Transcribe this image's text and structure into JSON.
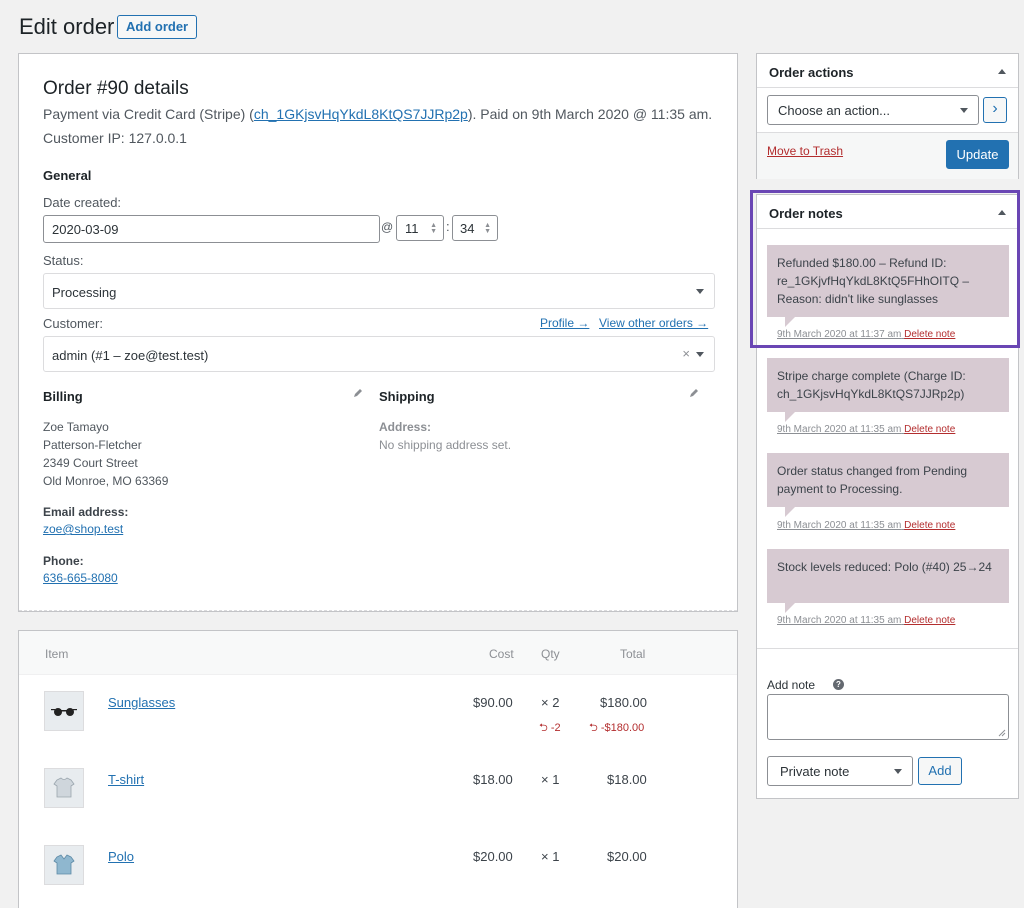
{
  "header": {
    "title": "Edit order",
    "add_order_label": "Add order"
  },
  "order": {
    "heading": "Order #90 details",
    "payment_prefix": "Payment via Credit Card (Stripe) (",
    "charge_id": "ch_1GKjsvHqYkdL8KtQS7JJRp2p",
    "payment_suffix": "). Paid on 9th March 2020 @ 11:35 am. Customer IP: 127.0.0.1",
    "general_title": "General",
    "date_created_label": "Date created:",
    "date_value": "2020-03-09",
    "at_symbol": "@",
    "hour": "11",
    "colon": ":",
    "minute": "34",
    "status_label": "Status:",
    "status_value": "Processing",
    "customer_label": "Customer:",
    "profile_link": "Profile →",
    "view_orders_link": "View other orders →",
    "customer_value": "admin (#1 – zoe@test.test)",
    "clear_symbol": "×",
    "billing_title": "Billing",
    "billing_address": [
      "Zoe Tamayo",
      "Patterson-Fletcher",
      "2349 Court Street",
      "Old Monroe, MO 63369"
    ],
    "email_label": "Email address:",
    "email_value": "zoe@shop.test",
    "phone_label": "Phone:",
    "phone_value": "636-665-8080",
    "shipping_title": "Shipping",
    "address_label": "Address:",
    "no_shipping": "No shipping address set."
  },
  "items": {
    "columns": {
      "item": "Item",
      "cost": "Cost",
      "qty": "Qty",
      "total": "Total"
    },
    "rows": [
      {
        "name": "Sunglasses",
        "cost": "$90.00",
        "qty": "× 2",
        "total": "$180.00",
        "refund_qty": "⮌ -2",
        "refund_total": "⮌ -$180.00"
      },
      {
        "name": "T-shirt",
        "cost": "$18.00",
        "qty": "× 1",
        "total": "$18.00"
      },
      {
        "name": "Polo",
        "cost": "$20.00",
        "qty": "× 1",
        "total": "$20.00"
      }
    ]
  },
  "actions": {
    "title": "Order actions",
    "select_value": "Choose an action...",
    "go_label": "›",
    "trash_label": "Move to Trash",
    "update_label": "Update"
  },
  "notes": {
    "title": "Order notes",
    "delete_label": "Delete note",
    "list": [
      {
        "text": "Refunded $180.00 – Refund ID: re_1GKjvfHqYkdL8KtQ5FHhOITQ – Reason: didn't like sunglasses",
        "meta": "9th March 2020 at 11:37 am"
      },
      {
        "text": "Stripe charge complete (Charge ID: ch_1GKjsvHqYkdL8KtQS7JJRp2p)",
        "meta": "9th March 2020 at 11:35 am"
      },
      {
        "text": "Order status changed from Pending payment to Processing.",
        "meta": "9th March 2020 at 11:35 am"
      },
      {
        "text": "Stock levels reduced: Polo (#40) 25→24",
        "meta": "9th March 2020 at 11:35 am"
      }
    ],
    "add_note_label": "Add note",
    "help_symbol": "?",
    "note_type_value": "Private note",
    "add_button_label": "Add"
  },
  "colors": {
    "accent": "#2271b1",
    "note_bg": "#d7cad2",
    "highlight": "#6a46b4",
    "danger": "#b32d2e"
  }
}
